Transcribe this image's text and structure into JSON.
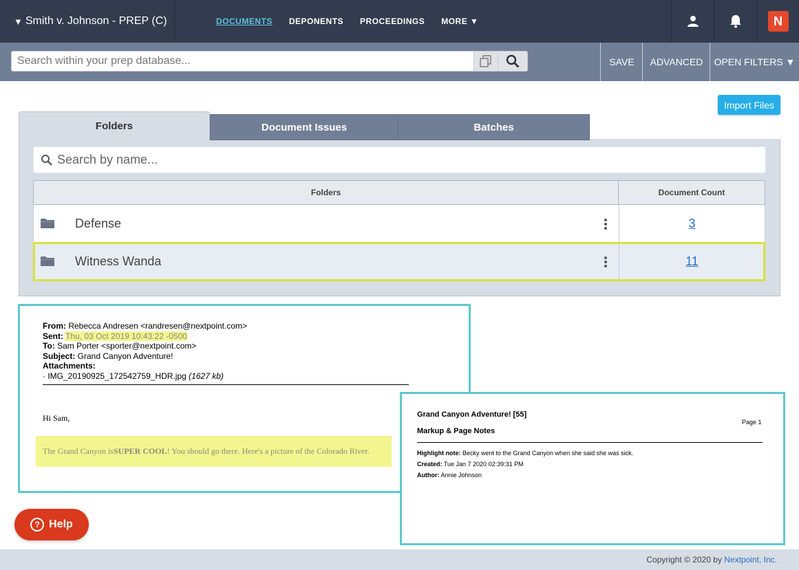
{
  "header": {
    "case_title": "Smith v. Johnson - PREP (C)",
    "case_caret": "▼",
    "nav": [
      "DOCUMENTS",
      "DEPONENTS",
      "PROCEEDINGS",
      "MORE ▼"
    ],
    "icons": [
      "user-icon",
      "bell-icon",
      "nextpoint-logo-icon"
    ],
    "logo_letter": "N"
  },
  "searchbar": {
    "placeholder": "Search within your prep database...",
    "buttons": [
      "SAVE",
      "ADVANCED",
      "OPEN FILTERS ▼"
    ]
  },
  "import_label": "Import Files",
  "tabs": [
    "Folders",
    "Document Issues",
    "Batches"
  ],
  "name_search_placeholder": "Search by name...",
  "table": {
    "headers": [
      "Folders",
      "Document Count"
    ],
    "rows": [
      {
        "name": "Defense",
        "count": "3"
      },
      {
        "name": "Witness Wanda",
        "count": "11"
      }
    ]
  },
  "email": {
    "from_label": "From:",
    "from_value": " Rebecca Andresen <randresen@nextpoint.com>",
    "sent_label": "Sent:",
    "sent_value": "Thu, 03 Oct 2019 10:43:22 -0500",
    "to_label": "To:",
    "to_value": " Sam Porter <sporter@nextpoint.com>",
    "subject_label": "Subject:",
    "subject_value": " Grand Canyon Adventure!",
    "attachments_label": "Attachments:",
    "attachment_name": "· IMG_20190925_172542759_HDR.jpg",
    "attachment_size": "(1627 kb)",
    "greeting": "Hi Sam,",
    "body_pre": "The Grand Canyon is ",
    "body_bold": "SUPER COOL",
    "body_post": "! You should go there. Here's a picture of the Colorado River."
  },
  "notes": {
    "title": "Grand Canyon Adventure! [55]",
    "page": "Page 1",
    "subtitle": "Markup & Page Notes",
    "highlight_label": "Highlight note:",
    "highlight_value": " Becky went to the Grand Canyon when she said she was sick.",
    "created_label": "Created:",
    "created_value": " Tue Jan  7 2020 02:39:31 PM",
    "author_label": "Author:",
    "author_value": " Annie Johnson"
  },
  "help_label": "Help",
  "footer": {
    "copyright": "Copyright © 2020 by ",
    "company": "Nextpoint, Inc."
  },
  "colors": {
    "nav_bg": "#323c4e",
    "active_link": "#5fbfe0",
    "import_btn": "#25aee8",
    "highlight_row_border": "#d8e23c",
    "preview_border": "#5ec8cf",
    "help_btn": "#d9391c",
    "logo": "#e5492a"
  }
}
